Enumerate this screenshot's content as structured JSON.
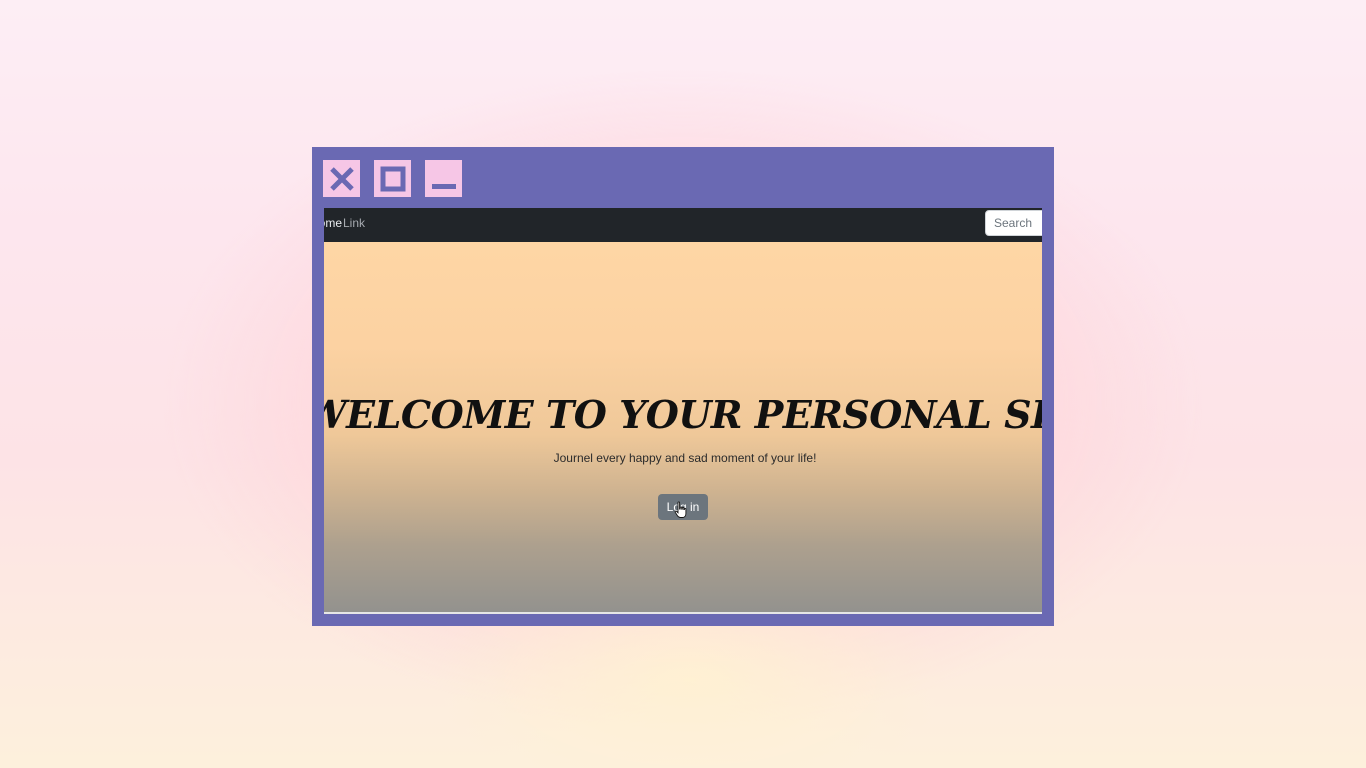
{
  "window_controls": {
    "close_icon": "close-x-icon",
    "maximize_icon": "maximize-square-icon",
    "minimize_icon": "minimize-bar-icon"
  },
  "navbar": {
    "home_label": "Home",
    "link_label": "Link",
    "search_placeholder": "Search"
  },
  "hero": {
    "title": "WELCOME TO YOUR PERSONAL SPACE",
    "subtitle": "Journel every happy and sad moment of your life!",
    "login_label": "Log in"
  },
  "colors": {
    "window_frame": "#6a69b3",
    "control_button": "#f6c6e6",
    "navbar_bg": "#212529",
    "hero_top": "#fed6a5",
    "hero_bottom": "#93928e",
    "login_button": "#6c757d"
  }
}
